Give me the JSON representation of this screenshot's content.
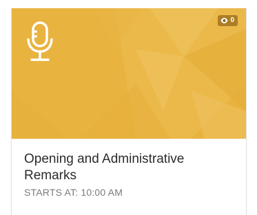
{
  "card": {
    "title": "Opening and Administrative Remarks",
    "time": "STARTS AT: 10:00 AM",
    "views": "0",
    "icon": "microphone-icon",
    "view_icon": "eye-icon",
    "banner_color": "#e8b33f"
  }
}
